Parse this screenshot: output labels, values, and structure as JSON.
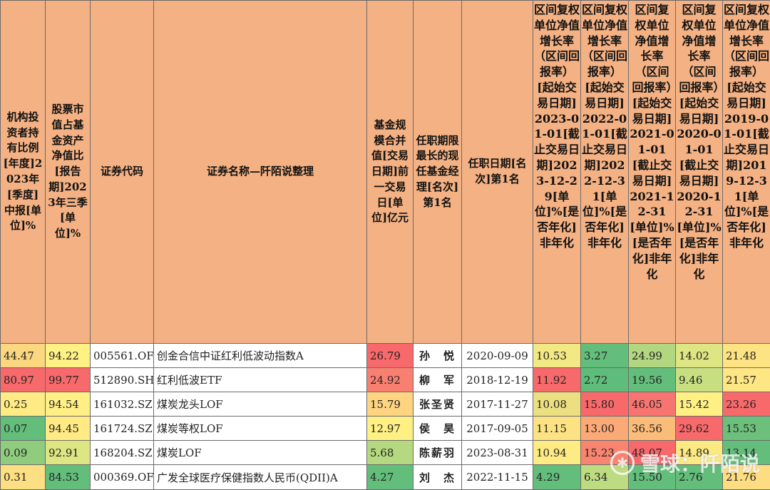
{
  "headers": {
    "inst_holding": "机构投资者持有比例[年度]2023年[季度]中报[单位]%",
    "stock_ratio": "股票市值占基金资产净值比[报告期]2023年三季[单位]%",
    "code": "证券代码",
    "name": "证券名称—阡陌说整理",
    "scale": "基金规模合并值[交易日期]前一交易日[单位]亿元",
    "manager": "任职期限最长的现任基金经理[名次]第1名",
    "start_date": "任职日期[名次]第1名",
    "ret_2023": "区间复权单位净值增长率（区间回报率）[起始交易日期]2023-01-01[截止交易日期]2023-12-29[单位]%[是否年化]非年化",
    "ret_2022": "区间复权单位净值增长率（区间回报率）[起始交易日期]2022-01-01[截止交易日期]2022-12-31[单位]%[是否年化]非年化",
    "ret_2021": "区间复权单位净值增长率（区间回报率）[起始交易日期]2021-01-01[截止交易日期]2021-12-31[单位]%[是否年化]非年化",
    "ret_2020": "区间复权单位净值增长率（区间回报率）[起始交易日期]2020-01-01[截止交易日期]2020-12-31[单位]%[是否年化]非年化",
    "ret_2019": "区间复权单位净值增长率（区间回报率）[起始交易日期]2019-01-01[截止交易日期]2019-12-31[单位]%[是否年化]非年化"
  },
  "rows": [
    {
      "inst": "44.47",
      "stock": "94.22",
      "code": "005561.OF",
      "name": "创金合信中证红利低波动指数A",
      "scale": "26.79",
      "manager": "孙　悦",
      "date": "2020-09-09",
      "r2023": "10.53",
      "r2022": "3.27",
      "r2021": "24.99",
      "r2020": "14.02",
      "r2019": "21.48"
    },
    {
      "inst": "80.97",
      "stock": "99.77",
      "code": "512890.SH",
      "name": "红利低波ETF",
      "scale": "24.92",
      "manager": "柳　军",
      "date": "2018-12-19",
      "r2023": "11.92",
      "r2022": "2.72",
      "r2021": "19.56",
      "r2020": "9.46",
      "r2019": "21.57"
    },
    {
      "inst": "0.25",
      "stock": "94.54",
      "code": "161032.SZ",
      "name": "煤炭龙头LOF",
      "scale": "15.79",
      "manager": "张圣贤",
      "date": "2017-11-27",
      "r2023": "10.08",
      "r2022": "15.80",
      "r2021": "46.05",
      "r2020": "15.42",
      "r2019": "23.26"
    },
    {
      "inst": "0.07",
      "stock": "94.45",
      "code": "161724.SZ",
      "name": "煤炭等权LOF",
      "scale": "12.97",
      "manager": "侯　昊",
      "date": "2017-09-05",
      "r2023": "11.15",
      "r2022": "13.00",
      "r2021": "36.56",
      "r2020": "29.62",
      "r2019": "15.53"
    },
    {
      "inst": "0.09",
      "stock": "92.91",
      "code": "168204.SZ",
      "name": "煤炭LOF",
      "scale": "5.68",
      "manager": "陈薪羽",
      "date": "2023-08-31",
      "r2023": "10.94",
      "r2022": "15.23",
      "r2021": "48.07",
      "r2020": "14.89",
      "r2019": "13.14"
    },
    {
      "inst": "0.31",
      "stock": "84.53",
      "code": "000369.OF",
      "name": "广发全球医疗保健指数人民币(QDII)A",
      "scale": "4.27",
      "manager": "刘　杰",
      "date": "2022-11-15",
      "r2023": "4.29",
      "r2022": "6.34",
      "r2021": "15.50",
      "r2020": "2.76",
      "r2019": "21.76"
    }
  ],
  "cell_colors": {
    "inst": [
      "#fbd77f",
      "#f8696b",
      "#ffeb84",
      "#63be7b",
      "#90cc7e",
      "#fcdf82"
    ],
    "stock": [
      "#fff184",
      "#f8696b",
      "#ffef85",
      "#ffea84",
      "#dde683",
      "#63be7b"
    ],
    "scale": [
      "#f8696b",
      "#f98070",
      "#fed480",
      "#fff084",
      "#b5d980",
      "#63be7b"
    ],
    "r2023": [
      "#f2e884",
      "#f8696b",
      "#ecdf81",
      "#fde283",
      "#ffeb84",
      "#63be7b"
    ],
    "r2022": [
      "#63be7b",
      "#5fbd7b",
      "#f8696b",
      "#fbaa77",
      "#f98470",
      "#bddb81"
    ],
    "r2021": [
      "#b3d680",
      "#63be7b",
      "#f87471",
      "#fbbc7a",
      "#f8696b",
      "#63be7b"
    ],
    "r2020": [
      "#dde683",
      "#c7df81",
      "#fff084",
      "#f8696b",
      "#fbe983",
      "#63be7b"
    ],
    "r2019": [
      "#fee383",
      "#fee683",
      "#f8696b",
      "#6dc07c",
      "#63be7b",
      "#fedd82"
    ]
  },
  "watermark": {
    "text": "雪球：阡陌说",
    "icon": "snowball-logo-icon"
  }
}
